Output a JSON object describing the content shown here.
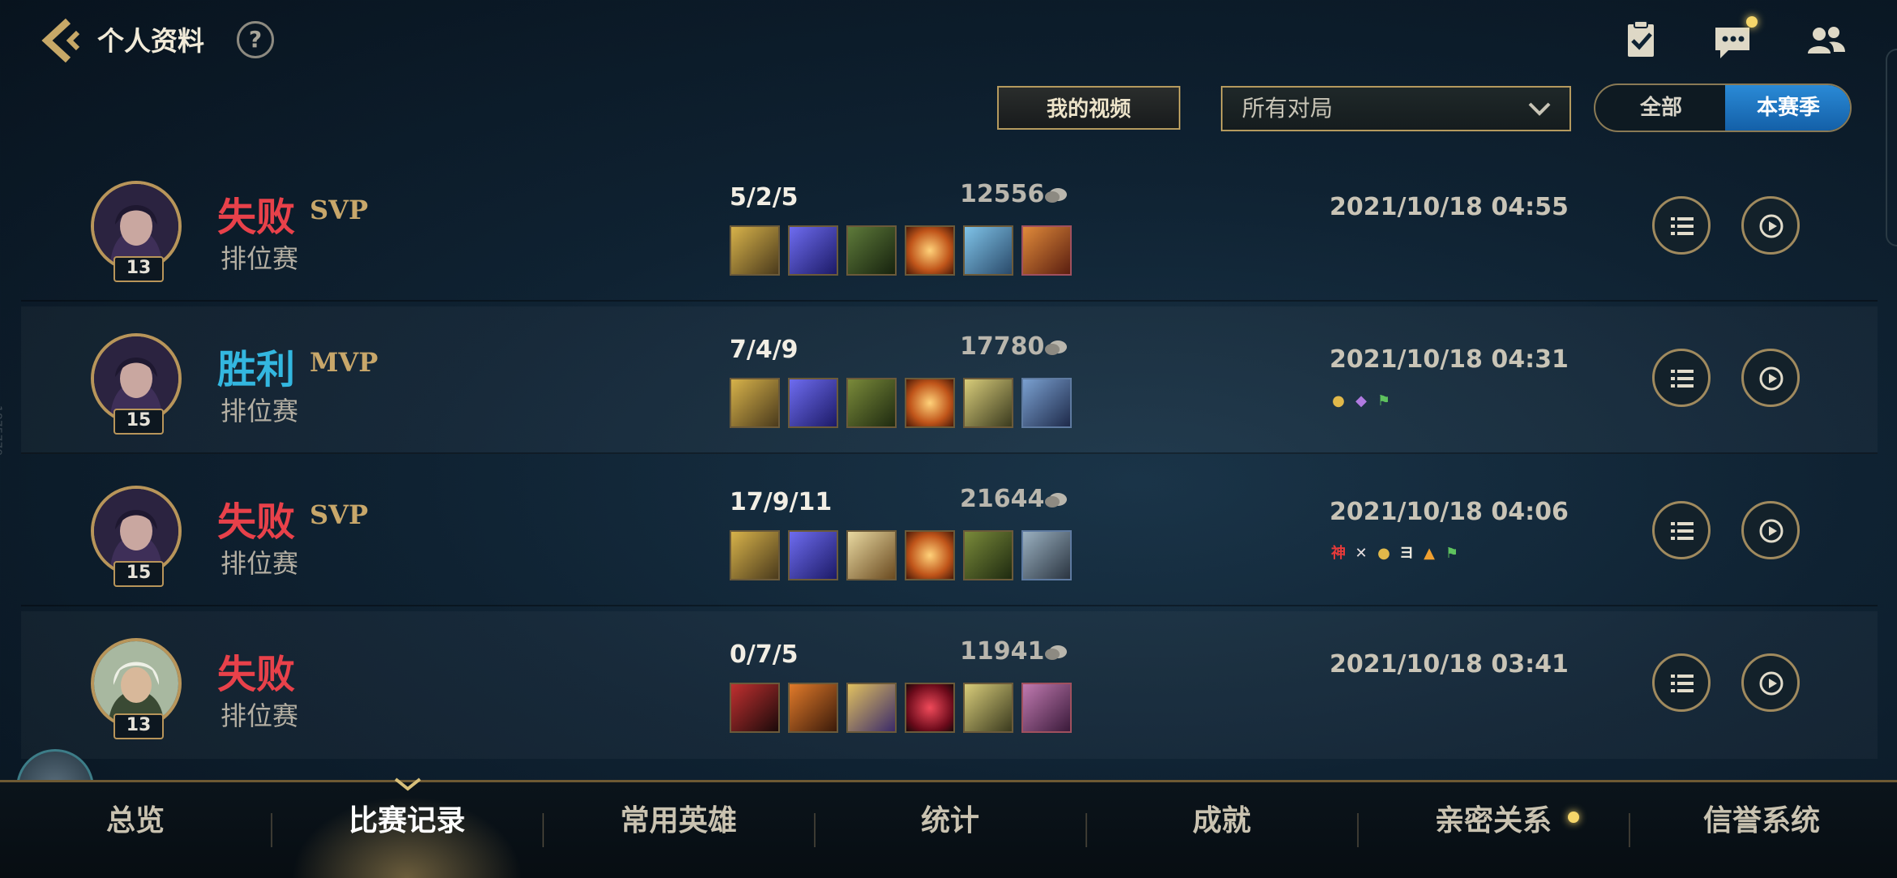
{
  "header": {
    "title": "个人资料",
    "help_label": "?"
  },
  "controls": {
    "video_label": "我的视频",
    "filter_value": "所有对局",
    "toggle_all": "全部",
    "toggle_season": "本赛季"
  },
  "side_text": "1875779",
  "matches": [
    {
      "result": "失败",
      "honor": "SVP",
      "mode": "排位赛",
      "level": "13",
      "kda": "5/2/5",
      "gold": "12556",
      "date": "2021/10/18 04:55"
    },
    {
      "result": "胜利",
      "honor": "MVP",
      "mode": "排位赛",
      "level": "15",
      "kda": "7/4/9",
      "gold": "17780",
      "date": "2021/10/18 04:31"
    },
    {
      "result": "失败",
      "honor": "SVP",
      "mode": "排位赛",
      "level": "15",
      "kda": "17/9/11",
      "gold": "21644",
      "date": "2021/10/18 04:06"
    },
    {
      "result": "失败",
      "honor": "",
      "mode": "排位赛",
      "level": "13",
      "kda": "0/7/5",
      "gold": "11941",
      "date": "2021/10/18 03:41"
    }
  ],
  "tags_row3": [
    "神",
    "",
    "",
    "ヨ",
    "",
    ""
  ],
  "nav": [
    "总览",
    "比赛记录",
    "常用英雄",
    "统计",
    "成就",
    "亲密关系",
    "信誉系统"
  ],
  "colors": {
    "lose": "#e8414a",
    "win": "#33b7e0",
    "gold_border": "#b59a5e",
    "toggle_active": "#1f74c0",
    "notification": "#f6d66a"
  }
}
